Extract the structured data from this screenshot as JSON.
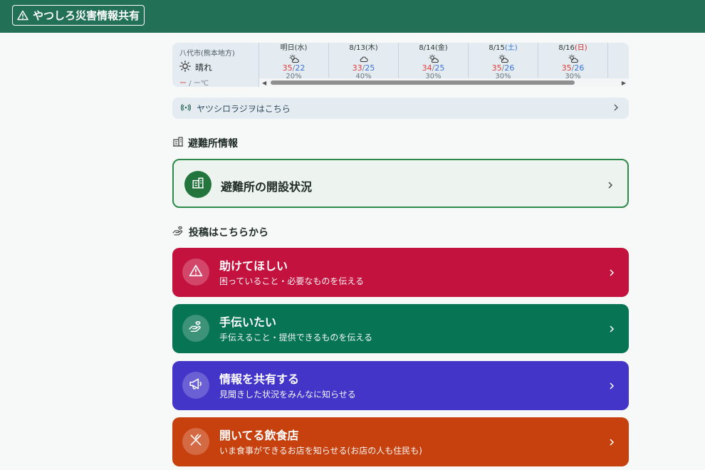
{
  "header": {
    "title": "やつしろ災害情報共有",
    "icon": "warning-triangle-icon"
  },
  "weather": {
    "city": "八代市(熊本地方)",
    "today": {
      "condition": "晴れ",
      "high": "ー",
      "sep": "/",
      "low": "ー℃"
    },
    "days": [
      {
        "date": "明日",
        "dow": "(水)",
        "icon": "sun-cloud-icon",
        "high": "35",
        "low": "22",
        "pop": "20%"
      },
      {
        "date": "8/13",
        "dow": "(木)",
        "icon": "cloud-icon",
        "high": "33",
        "low": "25",
        "pop": "40%"
      },
      {
        "date": "8/14",
        "dow": "(金)",
        "icon": "sun-cloud-icon",
        "high": "34",
        "low": "25",
        "pop": "30%"
      },
      {
        "date": "8/15",
        "dow": "(土)",
        "icon": "sun-cloud-icon",
        "high": "35",
        "low": "26",
        "pop": "30%"
      },
      {
        "date": "8/16",
        "dow": "(日)",
        "icon": "sun-cloud-icon",
        "high": "35",
        "low": "26",
        "pop": "30%"
      }
    ],
    "temp_sep": "/"
  },
  "radio": {
    "label": "ヤツシロラジヲはこちら"
  },
  "shelter_section": {
    "title": "避難所情報"
  },
  "shelter_card": {
    "title": "避難所の開設状況"
  },
  "post_section": {
    "title": "投稿はこちらから"
  },
  "cards": {
    "help": {
      "title": "助けてほしい",
      "subtitle": "困っていること・必要なものを伝える"
    },
    "assist": {
      "title": "手伝いたい",
      "subtitle": "手伝えること・提供できるものを伝える"
    },
    "share": {
      "title": "情報を共有する",
      "subtitle": "見聞きした状況をみんなに知らせる"
    },
    "food": {
      "title": "開いてる飲食店",
      "subtitle": "いま食事ができるお店を知らせる(お店の人も住民も)"
    }
  },
  "colors": {
    "header": "#227055",
    "help": "#c4123f",
    "assist": "#077553",
    "share": "#4235c8",
    "food": "#c7410f",
    "shelter_border": "#2c8a48"
  }
}
